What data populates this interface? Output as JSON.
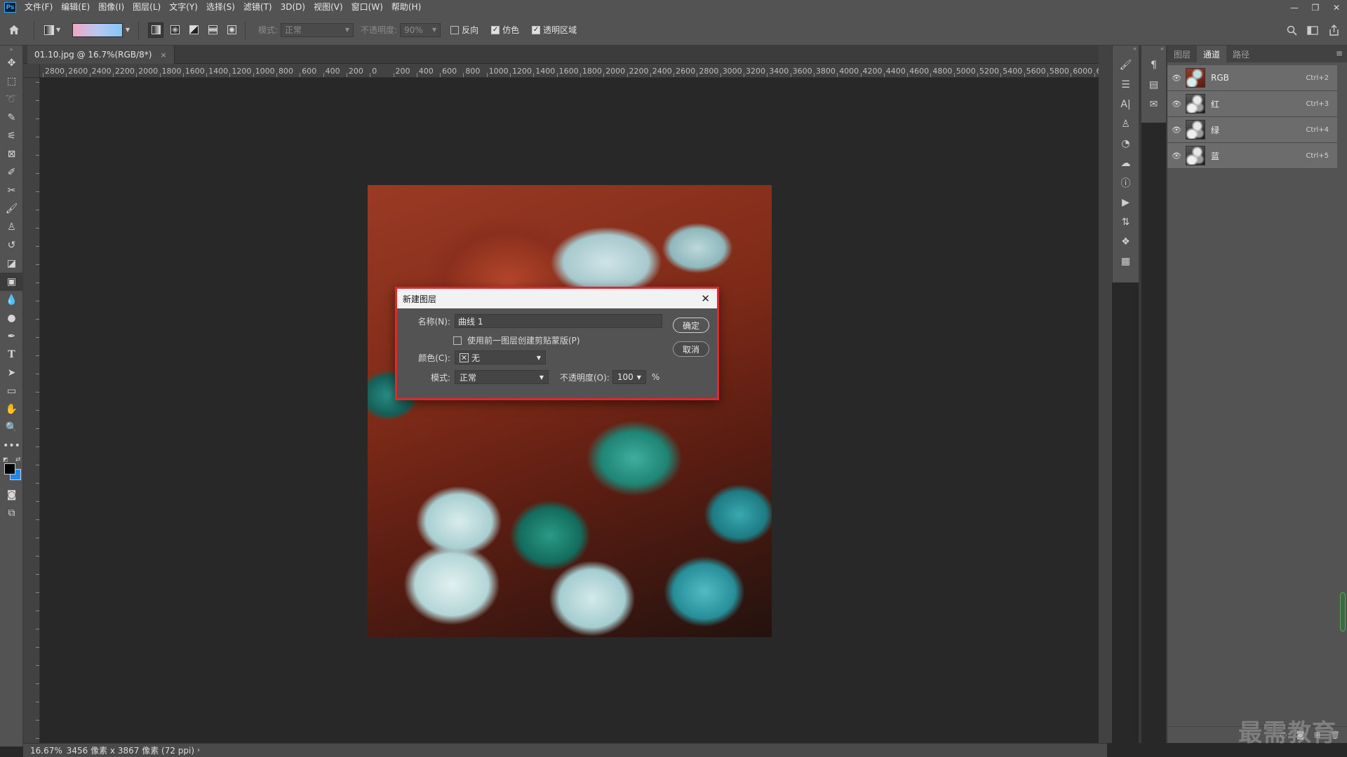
{
  "app": {
    "logo_text": "Ps",
    "menu": [
      "文件(F)",
      "编辑(E)",
      "图像(I)",
      "图层(L)",
      "文字(Y)",
      "选择(S)",
      "滤镜(T)",
      "3D(D)",
      "视图(V)",
      "窗口(W)",
      "帮助(H)"
    ],
    "window_controls": {
      "minimize": "—",
      "restore": "❐",
      "close": "✕"
    }
  },
  "options": {
    "mode_label": "模式:",
    "mode_value": "正常",
    "opacity_label": "不透明度:",
    "opacity_value": "90%",
    "reverse_label": "反向",
    "reverse_checked": false,
    "dither_label": "仿色",
    "dither_checked": true,
    "transparency_label": "透明区域",
    "transparency_checked": true
  },
  "document": {
    "tab_title": "01.10.jpg @ 16.7%(RGB/8*)",
    "tab_close": "×"
  },
  "ruler": {
    "top_labels": [
      "2800",
      "2600",
      "2400",
      "2200",
      "2000",
      "1800",
      "1600",
      "1400",
      "1200",
      "1000",
      "800",
      "600",
      "400",
      "200",
      "0",
      "200",
      "400",
      "600",
      "800",
      "1000",
      "1200",
      "1400",
      "1600",
      "1800",
      "2000",
      "2200",
      "2400",
      "2600",
      "2800",
      "3000",
      "3200",
      "3400",
      "3600",
      "3800",
      "4000",
      "4200",
      "4400",
      "4600",
      "4800",
      "5000",
      "5200",
      "5400",
      "5600",
      "5800",
      "6000",
      "6"
    ]
  },
  "dialog": {
    "title": "新建图层",
    "name_label": "名称(N):",
    "name_value": "曲线 1",
    "ok_button": "确定",
    "cancel_button": "取消",
    "clip_label": "使用前一图层创建剪贴蒙版(P)",
    "clip_checked": false,
    "color_label": "颜色(C):",
    "color_value": "无",
    "mode_label": "模式:",
    "mode_value": "正常",
    "opacity_label": "不透明度(O):",
    "opacity_value": "100",
    "opacity_unit": "%"
  },
  "panel": {
    "tabs": [
      "图层",
      "通道",
      "路径"
    ],
    "active_tab": "通道",
    "channels": [
      {
        "name": "RGB",
        "shortcut": "Ctrl+2"
      },
      {
        "name": "红",
        "shortcut": "Ctrl+3"
      },
      {
        "name": "绿",
        "shortcut": "Ctrl+4"
      },
      {
        "name": "蓝",
        "shortcut": "Ctrl+5"
      }
    ]
  },
  "status": {
    "zoom": "16.67%",
    "info": "3456 像素 x 3867 像素 (72 ppi)",
    "caret": "›"
  },
  "watermark": "最需教育",
  "icons": {
    "home": "home-icon",
    "search": "search-icon",
    "workspace": "workspace-icon",
    "share": "share-icon",
    "eye": "eye-icon"
  }
}
